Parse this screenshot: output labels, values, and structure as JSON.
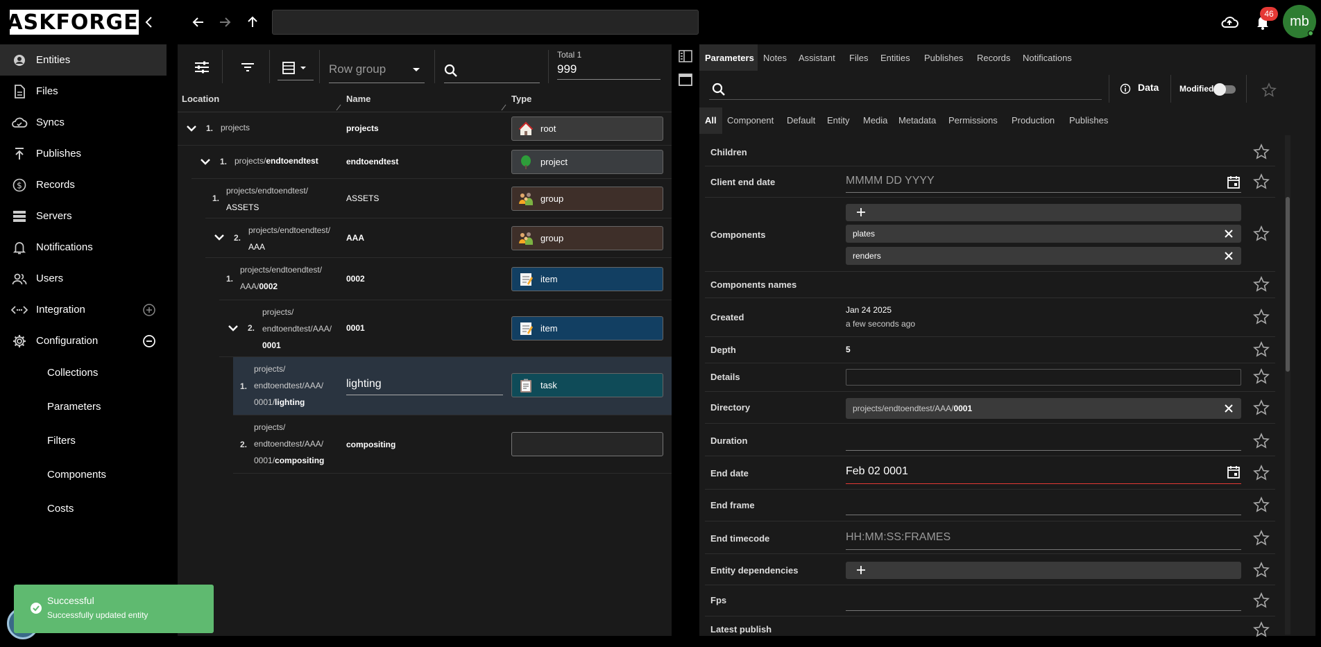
{
  "app": {
    "logo": "TASKFORGER"
  },
  "header": {
    "address": "",
    "notifications_count": "46",
    "avatar_initials": "mb"
  },
  "sidebar": {
    "items": [
      {
        "label": "Entities",
        "icon": "entities-icon"
      },
      {
        "label": "Files",
        "icon": "file-icon"
      },
      {
        "label": "Syncs",
        "icon": "cloud-sync-icon"
      },
      {
        "label": "Publishes",
        "icon": "publish-icon"
      },
      {
        "label": "Records",
        "icon": "dollar-icon"
      },
      {
        "label": "Servers",
        "icon": "server-icon"
      },
      {
        "label": "Notifications",
        "icon": "bell-icon"
      },
      {
        "label": "Users",
        "icon": "users-icon"
      },
      {
        "label": "Integration",
        "icon": "integration-icon"
      },
      {
        "label": "Configuration",
        "icon": "gear-icon"
      }
    ],
    "sub_items": [
      "Collections",
      "Parameters",
      "Filters",
      "Components",
      "Costs"
    ]
  },
  "toast": {
    "title": "Successful",
    "message": "Successfully updated entity"
  },
  "tree": {
    "rowgroup_label": "Row group",
    "total_label": "Total 1",
    "total_value": "999",
    "columns": [
      "Location",
      "Name",
      "Type"
    ],
    "rows": [
      {
        "num": "1.",
        "loc_plain": "projects",
        "loc_bold": "",
        "name": "projects",
        "type": "root"
      },
      {
        "num": "1.",
        "loc_plain": "projects/",
        "loc_bold": "endtoendtest",
        "name": "endtoendtest",
        "type": "project"
      },
      {
        "num": "1.",
        "loc_line1": "projects/endtoendtest/",
        "loc_line2": "ASSETS",
        "name": "ASSETS",
        "type": "group"
      },
      {
        "num": "2.",
        "loc_line1": "projects/endtoendtest/",
        "loc_line2": "AAA",
        "name": "AAA",
        "type": "group"
      },
      {
        "num": "1.",
        "loc_line1": "projects/endtoendtest/",
        "loc_line2_plain": "AAA/",
        "loc_line2_bold": "0002",
        "name": "0002",
        "type": "item"
      },
      {
        "num": "2.",
        "loc_line1": "projects/",
        "loc_line2": "endtoendtest/AAA/",
        "loc_line3": "0001",
        "name": "0001",
        "type": "item"
      },
      {
        "num": "1.",
        "loc_line1": "projects/",
        "loc_line2": "endtoendtest/AAA/",
        "loc_line3_plain": "0001/",
        "loc_line3_bold": "lighting",
        "name": "lighting",
        "type": "task"
      },
      {
        "num": "2.",
        "loc_line1": "projects/",
        "loc_line2": "endtoendtest/AAA/",
        "loc_line3_plain": "0001/",
        "loc_line3_bold": "compositing",
        "name": "compositing",
        "type": ""
      }
    ]
  },
  "panel": {
    "tabs": [
      "Parameters",
      "Notes",
      "Assistant",
      "Files",
      "Entities",
      "Publishes",
      "Records",
      "Notifications"
    ],
    "data_label": "Data",
    "modified_label": "Modified",
    "categories": [
      "All",
      "Component",
      "Default",
      "Entity",
      "Media",
      "Metadata",
      "Permissions",
      "Production",
      "Publishes"
    ],
    "params": {
      "children": "Children",
      "client_end_date": "Client end date",
      "client_end_date_placeholder": "MMMM DD YYYY",
      "components": "Components",
      "component_values": [
        "plates",
        "renders"
      ],
      "components_names": "Components names",
      "created": "Created",
      "created_date": "Jan 24 2025",
      "created_relative": "a few seconds ago",
      "depth": "Depth",
      "depth_value": "5",
      "details": "Details",
      "directory": "Directory",
      "directory_plain": "projects/endtoendtest/AAA/",
      "directory_bold": "0001",
      "duration": "Duration",
      "end_date": "End date",
      "end_date_value": "Feb 02 0001",
      "end_frame": "End frame",
      "end_timecode": "End timecode",
      "end_timecode_placeholder": "HH:MM:SS:FRAMES",
      "entity_dependencies": "Entity dependencies",
      "fps": "Fps",
      "latest_publish": "Latest publish"
    }
  },
  "colors": {
    "toast": "#5fba70",
    "badge": "#e53935",
    "avatar": "#2e7d32",
    "item_chip": "#123f62",
    "task_chip": "#0f4b58",
    "group_chip": "#3e2f29"
  }
}
